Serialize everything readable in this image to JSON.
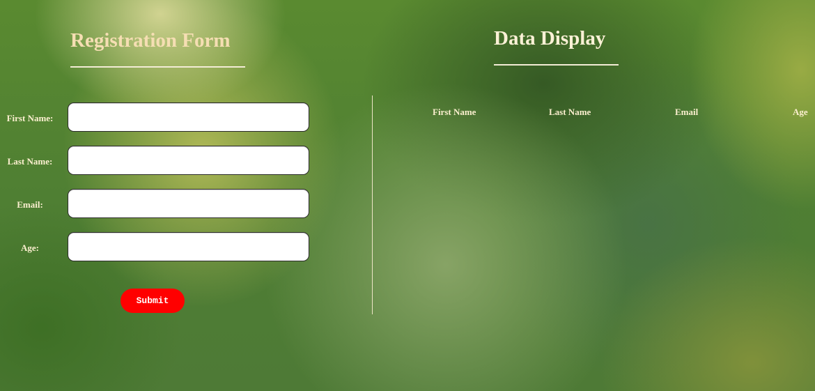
{
  "registration": {
    "title": "Registration Form",
    "fields": {
      "first_name": {
        "label": "First Name:",
        "value": "",
        "placeholder": ""
      },
      "last_name": {
        "label": "Last Name:",
        "value": "",
        "placeholder": ""
      },
      "email": {
        "label": "Email:",
        "value": "",
        "placeholder": ""
      },
      "age": {
        "label": "Age:",
        "value": "",
        "placeholder": ""
      }
    },
    "submit_label": "Submit"
  },
  "display": {
    "title": "Data Display",
    "columns": [
      "First Name",
      "Last Name",
      "Email",
      "Age"
    ],
    "rows": []
  },
  "colors": {
    "heading_text": "#f5deb3",
    "submit_background": "#ff0000",
    "submit_text": "#ffffff"
  }
}
